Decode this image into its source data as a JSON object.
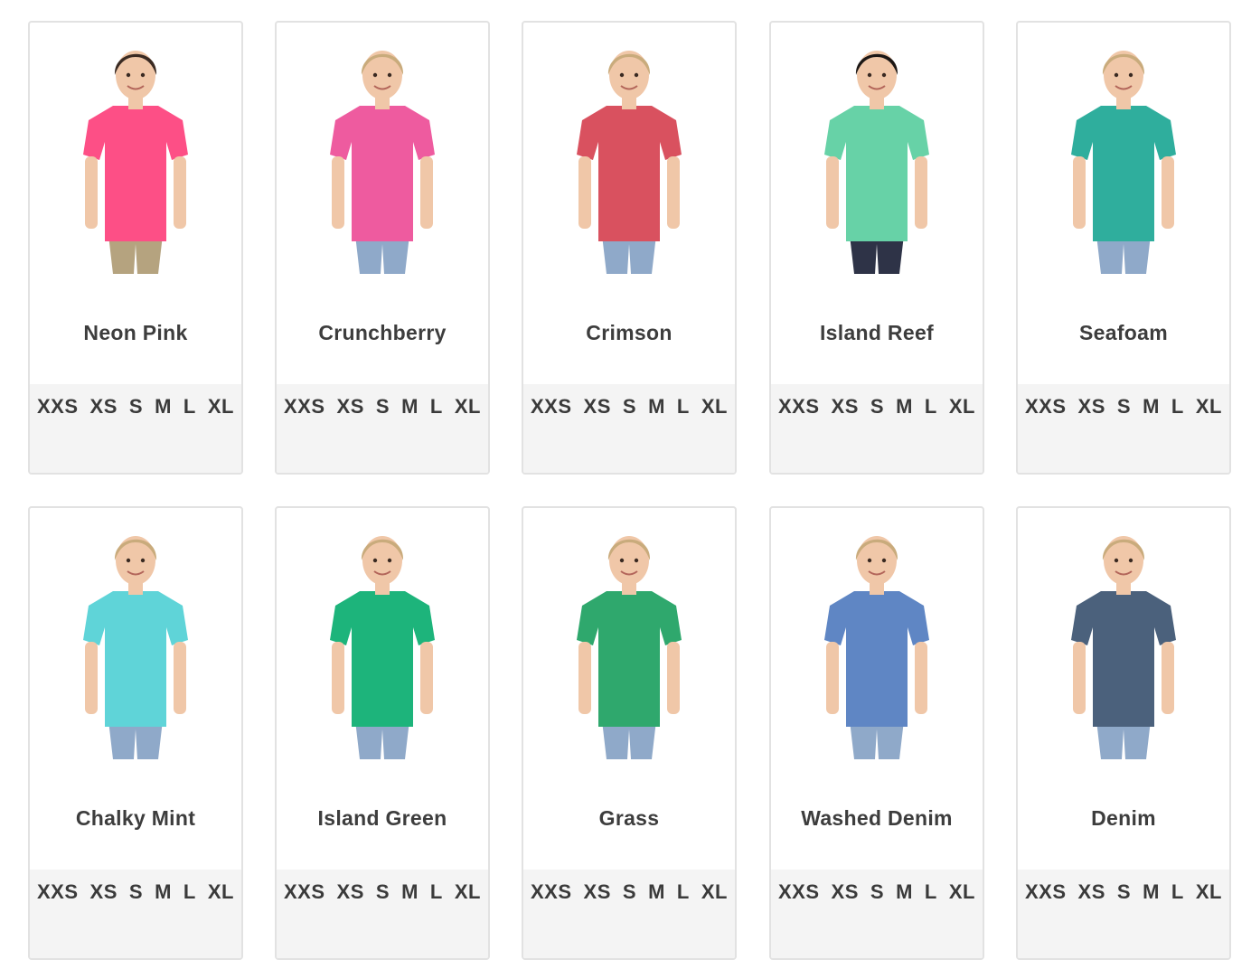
{
  "products": [
    {
      "name": "Neon Pink",
      "shirt_color": "#fd4f86",
      "hair_color": "#3a2a22",
      "pants_color": "#b5a37f",
      "sizes": [
        "XXS",
        "XS",
        "S",
        "M",
        "L",
        "XL"
      ]
    },
    {
      "name": "Crunchberry",
      "shirt_color": "#ee5b9f",
      "hair_color": "#c9ab7c",
      "pants_color": "#8fa9c9",
      "sizes": [
        "XXS",
        "XS",
        "S",
        "M",
        "L",
        "XL"
      ]
    },
    {
      "name": "Crimson",
      "shirt_color": "#d9515f",
      "hair_color": "#c9ab7c",
      "pants_color": "#8fa9c9",
      "sizes": [
        "XXS",
        "XS",
        "S",
        "M",
        "L",
        "XL"
      ]
    },
    {
      "name": "Island Reef",
      "shirt_color": "#67d2a7",
      "hair_color": "#1c1715",
      "pants_color": "#2e3347",
      "sizes": [
        "XXS",
        "XS",
        "S",
        "M",
        "L",
        "XL"
      ]
    },
    {
      "name": "Seafoam",
      "shirt_color": "#2fae9d",
      "hair_color": "#c9ab7c",
      "pants_color": "#8fa9c9",
      "sizes": [
        "XXS",
        "XS",
        "S",
        "M",
        "L",
        "XL"
      ]
    },
    {
      "name": "Chalky Mint",
      "shirt_color": "#5fd4d8",
      "hair_color": "#c9ab7c",
      "pants_color": "#8fa9c9",
      "sizes": [
        "XXS",
        "XS",
        "S",
        "M",
        "L",
        "XL"
      ]
    },
    {
      "name": "Island Green",
      "shirt_color": "#1db47b",
      "hair_color": "#c9ab7c",
      "pants_color": "#8fa9c9",
      "sizes": [
        "XXS",
        "XS",
        "S",
        "M",
        "L",
        "XL"
      ]
    },
    {
      "name": "Grass",
      "shirt_color": "#2fa86d",
      "hair_color": "#c9ab7c",
      "pants_color": "#8fa9c9",
      "sizes": [
        "XXS",
        "XS",
        "S",
        "M",
        "L",
        "XL"
      ]
    },
    {
      "name": "Washed Denim",
      "shirt_color": "#5f86c4",
      "hair_color": "#c9ab7c",
      "pants_color": "#8fa9c9",
      "sizes": [
        "XXS",
        "XS",
        "S",
        "M",
        "L",
        "XL"
      ]
    },
    {
      "name": "Denim",
      "shirt_color": "#4b617c",
      "hair_color": "#c9ab7c",
      "pants_color": "#8fa9c9",
      "sizes": [
        "XXS",
        "XS",
        "S",
        "M",
        "L",
        "XL"
      ]
    }
  ]
}
